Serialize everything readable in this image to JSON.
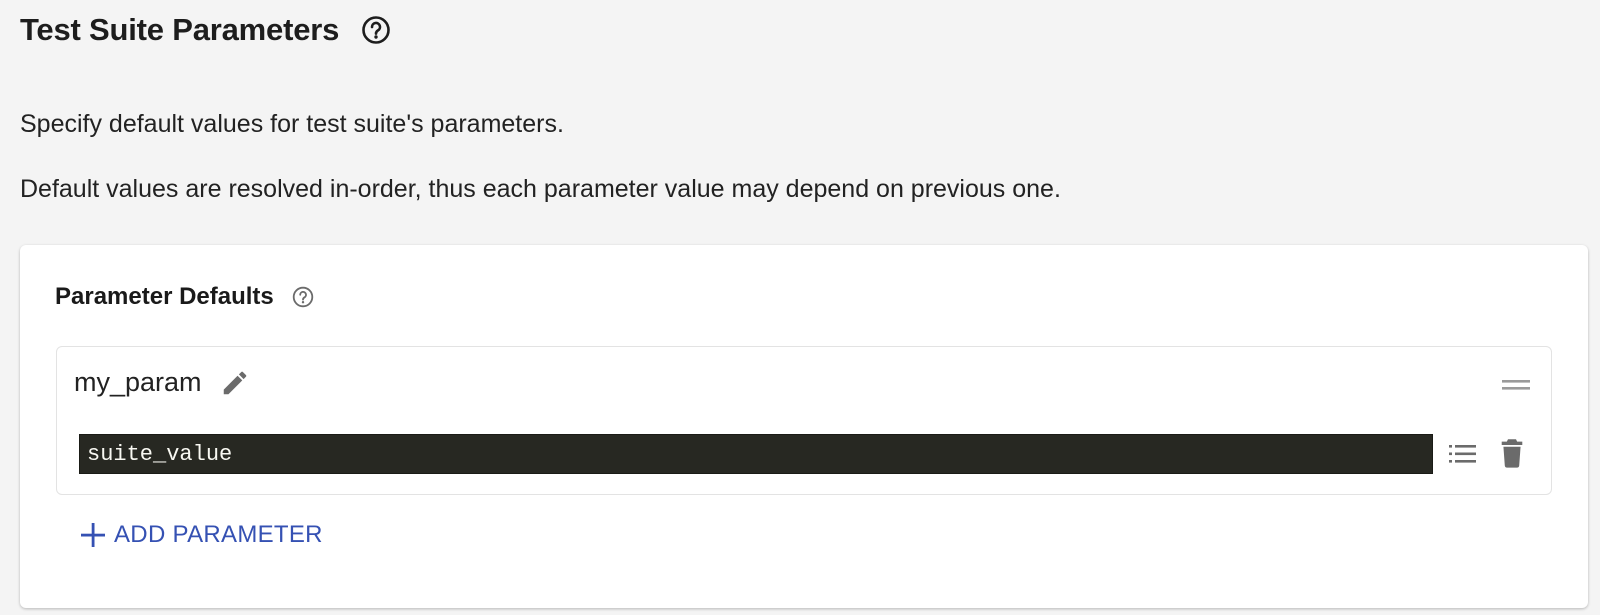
{
  "header": {
    "title": "Test Suite Parameters",
    "help_icon": "help-circle-icon"
  },
  "description": {
    "line1": "Specify default values for test suite's parameters.",
    "line2": "Default values are resolved in-order, thus each parameter value may depend on previous one."
  },
  "card": {
    "title": "Parameter Defaults",
    "help_icon": "help-circle-icon",
    "parameters": [
      {
        "name": "my_param",
        "value": "suite_value",
        "icons": [
          "edit-icon",
          "drag-handle-icon",
          "list-icon",
          "delete-icon"
        ]
      }
    ],
    "add_button_label": "ADD PARAMETER",
    "add_icon": "plus-icon"
  },
  "colors": {
    "page_background": "#f4f4f4",
    "card_background": "#ffffff",
    "editor_background": "#272822",
    "editor_text": "#f8f8f2",
    "accent": "#3551b3",
    "icon_gray": "#6b6b6b"
  }
}
